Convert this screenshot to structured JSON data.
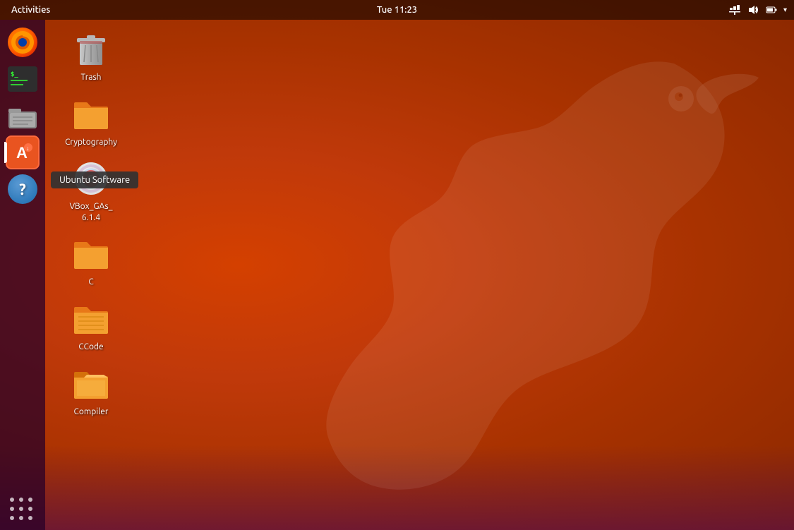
{
  "topPanel": {
    "activities": "Activities",
    "clock": "Tue 11:23"
  },
  "dock": {
    "items": [
      {
        "id": "firefox",
        "label": "Firefox"
      },
      {
        "id": "terminal",
        "label": "Terminal"
      },
      {
        "id": "files",
        "label": "Files"
      },
      {
        "id": "ubuntu-software",
        "label": "Ubuntu Software",
        "active": true,
        "tooltip": "Ubuntu Software"
      },
      {
        "id": "help",
        "label": "Help"
      }
    ],
    "appsGrid": "Show Applications"
  },
  "desktop": {
    "icons": [
      {
        "id": "trash",
        "type": "trash",
        "label": "Trash"
      },
      {
        "id": "cryptography",
        "type": "folder-orange",
        "label": "Cryptography"
      },
      {
        "id": "vbox",
        "type": "cd",
        "label": "VBox_GAs_\n6.1.4"
      },
      {
        "id": "c",
        "type": "folder-orange",
        "label": "C"
      },
      {
        "id": "ccode",
        "type": "folder-orange-stripe",
        "label": "CCode"
      },
      {
        "id": "compiler",
        "type": "folder-orange-open",
        "label": "Compiler"
      }
    ]
  }
}
